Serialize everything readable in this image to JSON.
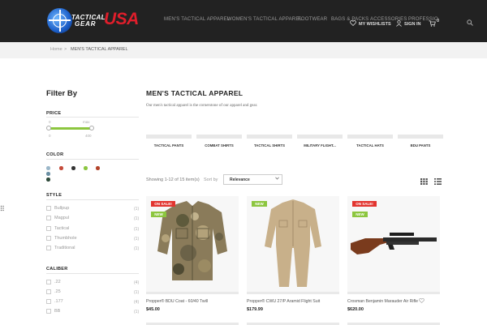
{
  "brand": {
    "line1": "TACTICAL",
    "line2": "GEAR",
    "usa": "USA"
  },
  "nav": [
    "MEN'S TACTICAL APPAREL",
    "WOMEN'S TACTICAL APPAREL",
    "FOOTWEAR",
    "BAGS & PACKS",
    "ACCESSORIES",
    "PROFESSIO"
  ],
  "header_utils": {
    "wishlist": "MY WISHLISTS",
    "signin": "SIGN IN",
    "cart_count": "0"
  },
  "breadcrumb": {
    "home": "Home",
    "sep": ">",
    "current": "MEN'S TACTICAL APPAREL"
  },
  "sidebar": {
    "title": "Filter By",
    "price": {
      "heading": "PRICE",
      "min_label": "0",
      "max_label": "max",
      "min_value": "0",
      "max_value": "400",
      "selected_fraction": 1.0
    },
    "color": {
      "heading": "COLOR",
      "swatches": [
        "#9bb7c9",
        "#c54b3a",
        "#333333",
        "#8cc63f",
        "#b3432a",
        "#6a8fa3",
        "#2e4a3a"
      ]
    },
    "style": {
      "heading": "STYLE",
      "items": [
        {
          "label": "Bullpup",
          "count": "(1)"
        },
        {
          "label": "Magpul",
          "count": "(1)"
        },
        {
          "label": "Tactical",
          "count": "(1)"
        },
        {
          "label": "Thumbhole",
          "count": "(1)"
        },
        {
          "label": "Traditional",
          "count": "(1)"
        }
      ]
    },
    "caliber": {
      "heading": "CALIBER",
      "items": [
        {
          "label": ".22",
          "count": "(4)"
        },
        {
          "label": ".25",
          "count": "(1)"
        },
        {
          "label": ".177",
          "count": "(4)"
        },
        {
          "label": "BB",
          "count": "(1)"
        }
      ]
    }
  },
  "main": {
    "title": "MEN'S TACTICAL APPAREL",
    "description": "Our men's tactical apparel is the cornerstone of our apparel and gear.",
    "categories": [
      "TACTICAL PANTS",
      "COMBAT SHIRTS",
      "TACTICAL SHIRTS",
      "MILITARY FLIGHT...",
      "TACTICAL HATS",
      "BDU PANTS"
    ],
    "showing": "Showing 1-12 of 15 item(s)",
    "sort_label": "Sort by",
    "sort_value": "Relevance"
  },
  "products": [
    {
      "name": "Propper® BDU Coat - 60/40 Twill",
      "price": "$45.00",
      "badges": [
        "ON SALE!",
        "NEW"
      ]
    },
    {
      "name": "Propper® CWU 27/P Aramid Flight Suit",
      "price": "$179.99",
      "badges": [
        "NEW"
      ]
    },
    {
      "name": "Crosman Benjamin Marauder Air Rifle",
      "price": "$620.00",
      "badges": [
        "ON SALE!",
        "NEW"
      ]
    }
  ]
}
